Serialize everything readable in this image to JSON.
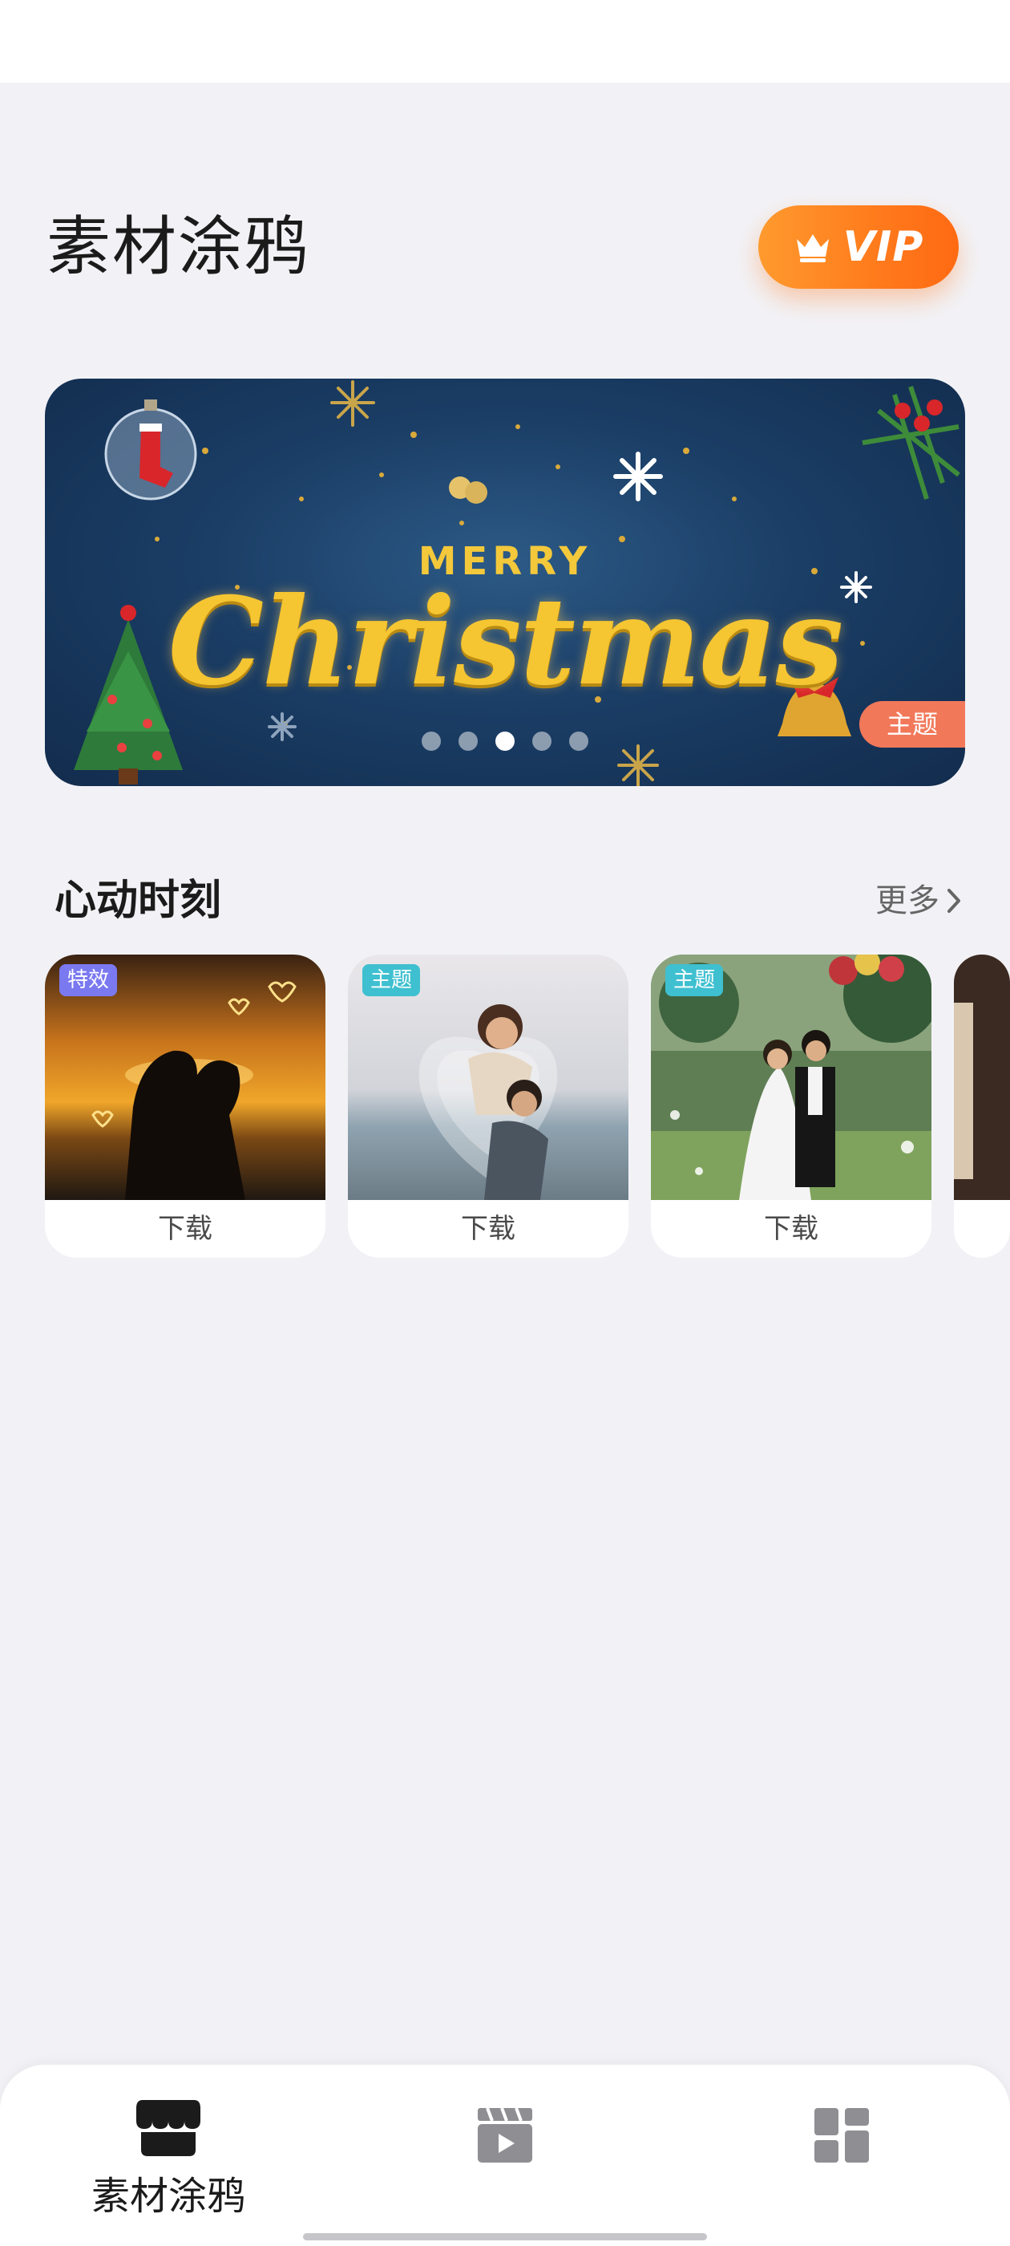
{
  "header": {
    "title": "素材涂鸦",
    "vip_label": "VIP"
  },
  "banner": {
    "line1": "MERRY",
    "line2": "Christmas",
    "tag": "主题",
    "dots_count": 5,
    "active_dot": 3
  },
  "section": {
    "title": "心动时刻",
    "more_label": "更多"
  },
  "cards": [
    {
      "badge": "特效",
      "badge_color": "#7a79f0",
      "action": "下载"
    },
    {
      "badge": "主题",
      "badge_color": "#3fc0d0",
      "action": "下载"
    },
    {
      "badge": "主题",
      "badge_color": "#3fc0d0",
      "action": "下载"
    }
  ],
  "tabs": [
    {
      "label": "素材涂鸦",
      "icon": "shop-icon",
      "active": true
    },
    {
      "label": "",
      "icon": "video-clapper-icon",
      "active": false
    },
    {
      "label": "",
      "icon": "grid-icon",
      "active": false
    }
  ],
  "colors": {
    "accent": "#ff7a1c",
    "background": "#f2f2f6",
    "banner_tag": "#f2785a"
  }
}
